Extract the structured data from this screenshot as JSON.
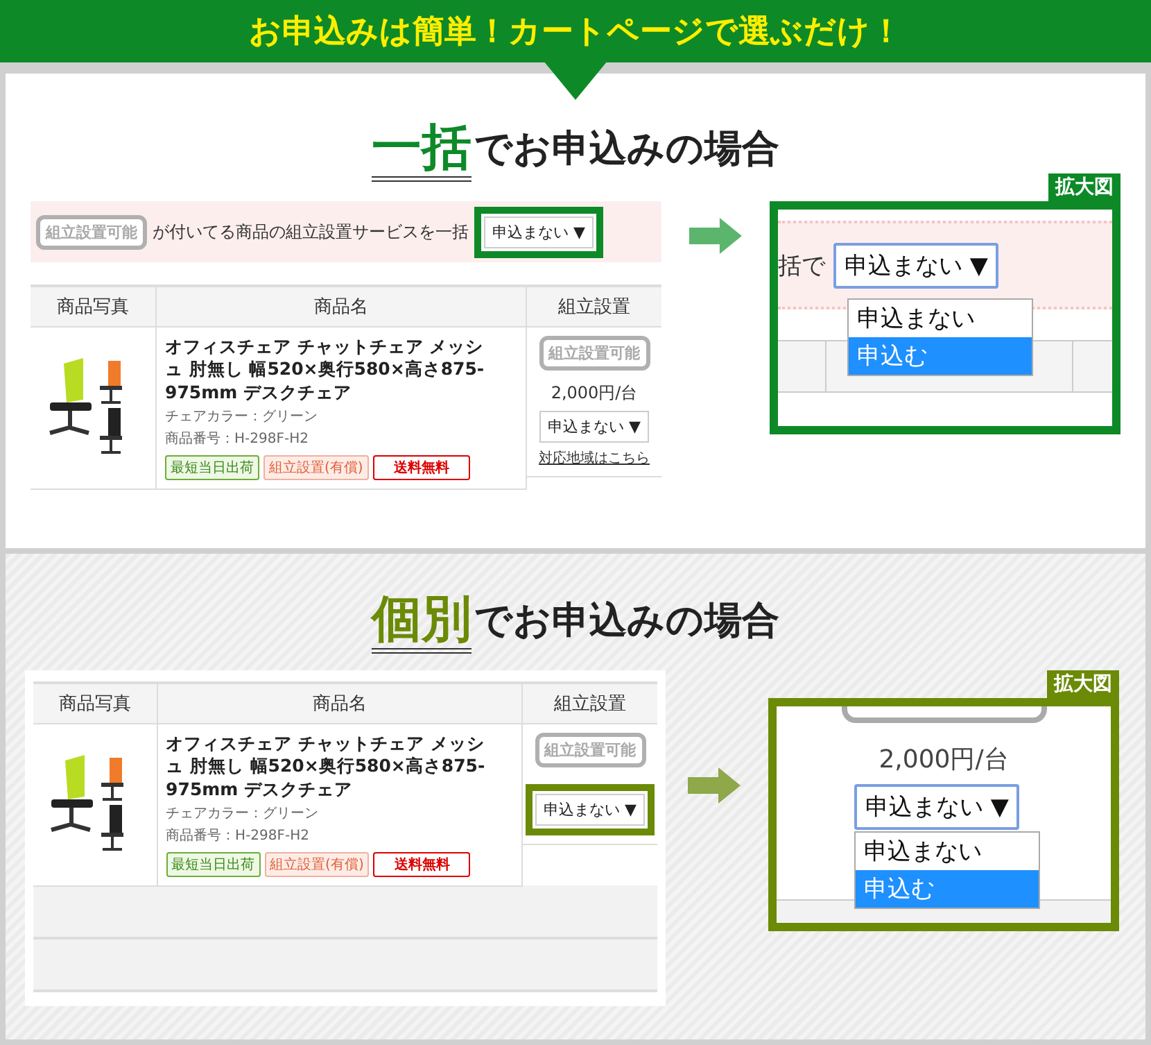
{
  "banner": {
    "title": "お申込みは簡単！カートページで選ぶだけ！"
  },
  "sections": [
    {
      "kind": "bulk",
      "heading_key": "一括",
      "heading_rest": "でお申込みの場合",
      "bulk_bar": {
        "badge": "組立設置可能",
        "text": "が付いてる商品の組立設置サービスを一括",
        "select": "申込まない ▼"
      },
      "table": {
        "columns": [
          "商品写真",
          "商品名",
          "組立設置"
        ],
        "rows": [
          {
            "name": "オフィスチェア チャットチェア メッシュ 肘無し 幅520×奥行580×高さ875-975mm デスクチェア",
            "color_text": "チェアカラー：グリーン",
            "code": "商品番号：H-298F-H2",
            "tags": [
              {
                "label": "最短当日出荷",
                "kind": "ship"
              },
              {
                "label": "組立設置(有償)",
                "kind": "assembly"
              },
              {
                "label": "送料無料",
                "kind": "free"
              }
            ],
            "badge": "組立設置可能",
            "price": "2,000円/台",
            "select": "申込まない ▼",
            "link": "対応地域はこちら"
          }
        ]
      },
      "zoom": {
        "label": "拡大図",
        "prefix": "括で",
        "select": "申込まない ▼",
        "options": [
          {
            "label": "申込まない",
            "selected": false
          },
          {
            "label": "申込む",
            "selected": true
          }
        ]
      }
    },
    {
      "kind": "individual",
      "heading_key": "個別",
      "heading_rest": "でお申込みの場合",
      "table": {
        "columns": [
          "商品写真",
          "商品名",
          "組立設置"
        ],
        "rows": [
          {
            "name": "オフィスチェア チャットチェア メッシュ 肘無し 幅520×奥行580×高さ875-975mm デスクチェア",
            "color_text": "チェアカラー：グリーン",
            "code": "商品番号：H-298F-H2",
            "tags": [
              {
                "label": "最短当日出荷",
                "kind": "ship"
              },
              {
                "label": "組立設置(有償)",
                "kind": "assembly"
              },
              {
                "label": "送料無料",
                "kind": "free"
              }
            ],
            "badge": "組立設置可能",
            "select": "申込まない ▼"
          }
        ]
      },
      "zoom": {
        "label": "拡大図",
        "price": "2,000円/台",
        "select": "申込まない ▼",
        "options": [
          {
            "label": "申込まない",
            "selected": false
          },
          {
            "label": "申込む",
            "selected": true
          }
        ]
      }
    }
  ]
}
